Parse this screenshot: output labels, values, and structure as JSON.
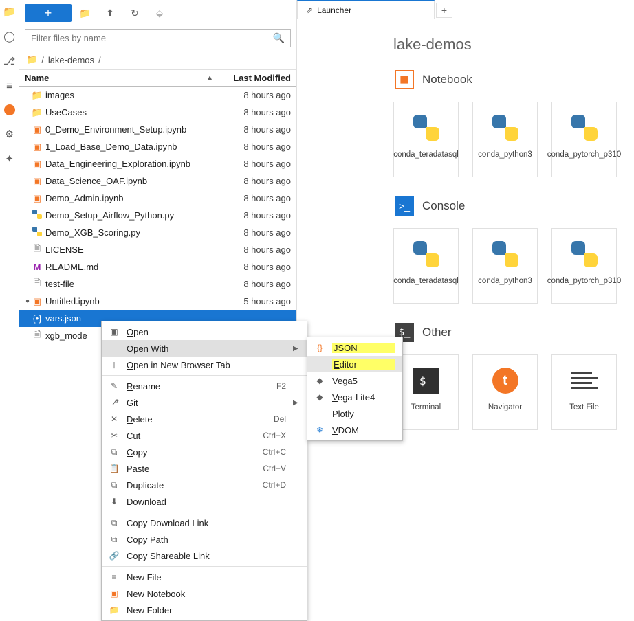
{
  "filter_placeholder": "Filter files by name",
  "breadcrumb_root": "lake-demos",
  "columns": {
    "name": "Name",
    "modified": "Last Modified"
  },
  "files": [
    {
      "icon": "folder",
      "name": "images",
      "mod": "8 hours ago",
      "dot": false
    },
    {
      "icon": "folder",
      "name": "UseCases",
      "mod": "8 hours ago",
      "dot": false
    },
    {
      "icon": "nb",
      "name": "0_Demo_Environment_Setup.ipynb",
      "mod": "8 hours ago",
      "dot": false
    },
    {
      "icon": "nb",
      "name": "1_Load_Base_Demo_Data.ipynb",
      "mod": "8 hours ago",
      "dot": false
    },
    {
      "icon": "nb",
      "name": "Data_Engineering_Exploration.ipynb",
      "mod": "8 hours ago",
      "dot": false
    },
    {
      "icon": "nb",
      "name": "Data_Science_OAF.ipynb",
      "mod": "8 hours ago",
      "dot": false
    },
    {
      "icon": "nb",
      "name": "Demo_Admin.ipynb",
      "mod": "8 hours ago",
      "dot": false
    },
    {
      "icon": "py",
      "name": "Demo_Setup_Airflow_Python.py",
      "mod": "8 hours ago",
      "dot": false
    },
    {
      "icon": "py",
      "name": "Demo_XGB_Scoring.py",
      "mod": "8 hours ago",
      "dot": false
    },
    {
      "icon": "file",
      "name": "LICENSE",
      "mod": "8 hours ago",
      "dot": false
    },
    {
      "icon": "md",
      "name": "README.md",
      "mod": "8 hours ago",
      "dot": false
    },
    {
      "icon": "file",
      "name": "test-file",
      "mod": "8 hours ago",
      "dot": false
    },
    {
      "icon": "nb",
      "name": "Untitled.ipynb",
      "mod": "5 hours ago",
      "dot": true
    },
    {
      "icon": "json",
      "name": "vars.json",
      "mod": "",
      "dot": false,
      "selected": true
    },
    {
      "icon": "file",
      "name": "xgb_mode",
      "mod": "",
      "dot": false
    }
  ],
  "context_menu": {
    "items": [
      {
        "icon": "▣",
        "label": "Open",
        "underline": "O"
      },
      {
        "icon": "",
        "label": "Open With",
        "sub": true,
        "hover": true
      },
      {
        "icon": "＋",
        "label": "Open in New Browser Tab",
        "underline": "O"
      },
      {
        "sep": true
      },
      {
        "icon": "✎",
        "label": "Rename",
        "underline": "R",
        "shortcut": "F2"
      },
      {
        "icon": "⎇",
        "label": "Git",
        "underline": "G",
        "sub": true
      },
      {
        "icon": "✕",
        "label": "Delete",
        "underline": "D",
        "shortcut": "Del"
      },
      {
        "icon": "✂",
        "label": "Cut",
        "shortcut": "Ctrl+X"
      },
      {
        "icon": "⧉",
        "label": "Copy",
        "underline": "C",
        "shortcut": "Ctrl+C"
      },
      {
        "icon": "📋",
        "label": "Paste",
        "underline": "P",
        "shortcut": "Ctrl+V"
      },
      {
        "icon": "⧉",
        "label": "Duplicate",
        "shortcut": "Ctrl+D"
      },
      {
        "icon": "⬇",
        "label": "Download"
      },
      {
        "sep": true
      },
      {
        "icon": "⧉",
        "label": "Copy Download Link"
      },
      {
        "icon": "⧉",
        "label": "Copy Path"
      },
      {
        "icon": "🔗",
        "label": "Copy Shareable Link"
      },
      {
        "sep": true
      },
      {
        "icon": "≡",
        "label": "New File"
      },
      {
        "icon": "▣",
        "label": "New Notebook",
        "iconcolor": "#f37626"
      },
      {
        "icon": "📁",
        "label": "New Folder"
      }
    ],
    "submenu": [
      {
        "icon": "{}",
        "label": "JSON",
        "underline": "J",
        "iconcolor": "#f37626",
        "hl": true
      },
      {
        "icon": "",
        "label": "Editor",
        "underline": "E",
        "hl": true,
        "hover": true
      },
      {
        "icon": "◆",
        "label": "Vega5",
        "underline": "V",
        "iconcolor": "#616161"
      },
      {
        "icon": "◆",
        "label": "Vega-Lite4",
        "underline": "V",
        "iconcolor": "#616161"
      },
      {
        "icon": "",
        "label": "Plotly",
        "underline": "P"
      },
      {
        "icon": "❄",
        "label": "VDOM",
        "underline": "V",
        "iconcolor": "#1976d2"
      }
    ]
  },
  "tabs": {
    "launcher": "Launcher"
  },
  "launcher": {
    "title": "lake-demos",
    "sections": [
      {
        "kind": "nb",
        "label": "Notebook",
        "cards": [
          {
            "icon": "py",
            "label": "conda_teradatasql"
          },
          {
            "icon": "py",
            "label": "conda_python3"
          },
          {
            "icon": "py",
            "label": "conda_pytorch_p310"
          }
        ]
      },
      {
        "kind": "con",
        "label": "Console",
        "cards": [
          {
            "icon": "py",
            "label": "conda_teradatasql"
          },
          {
            "icon": "py",
            "label": "conda_python3"
          },
          {
            "icon": "py",
            "label": "conda_pytorch_p310"
          }
        ]
      },
      {
        "kind": "oth",
        "label": "Other",
        "cards": [
          {
            "icon": "term",
            "label": "Terminal"
          },
          {
            "icon": "nav",
            "label": "Navigator"
          },
          {
            "icon": "txt",
            "label": "Text File"
          }
        ]
      }
    ]
  }
}
